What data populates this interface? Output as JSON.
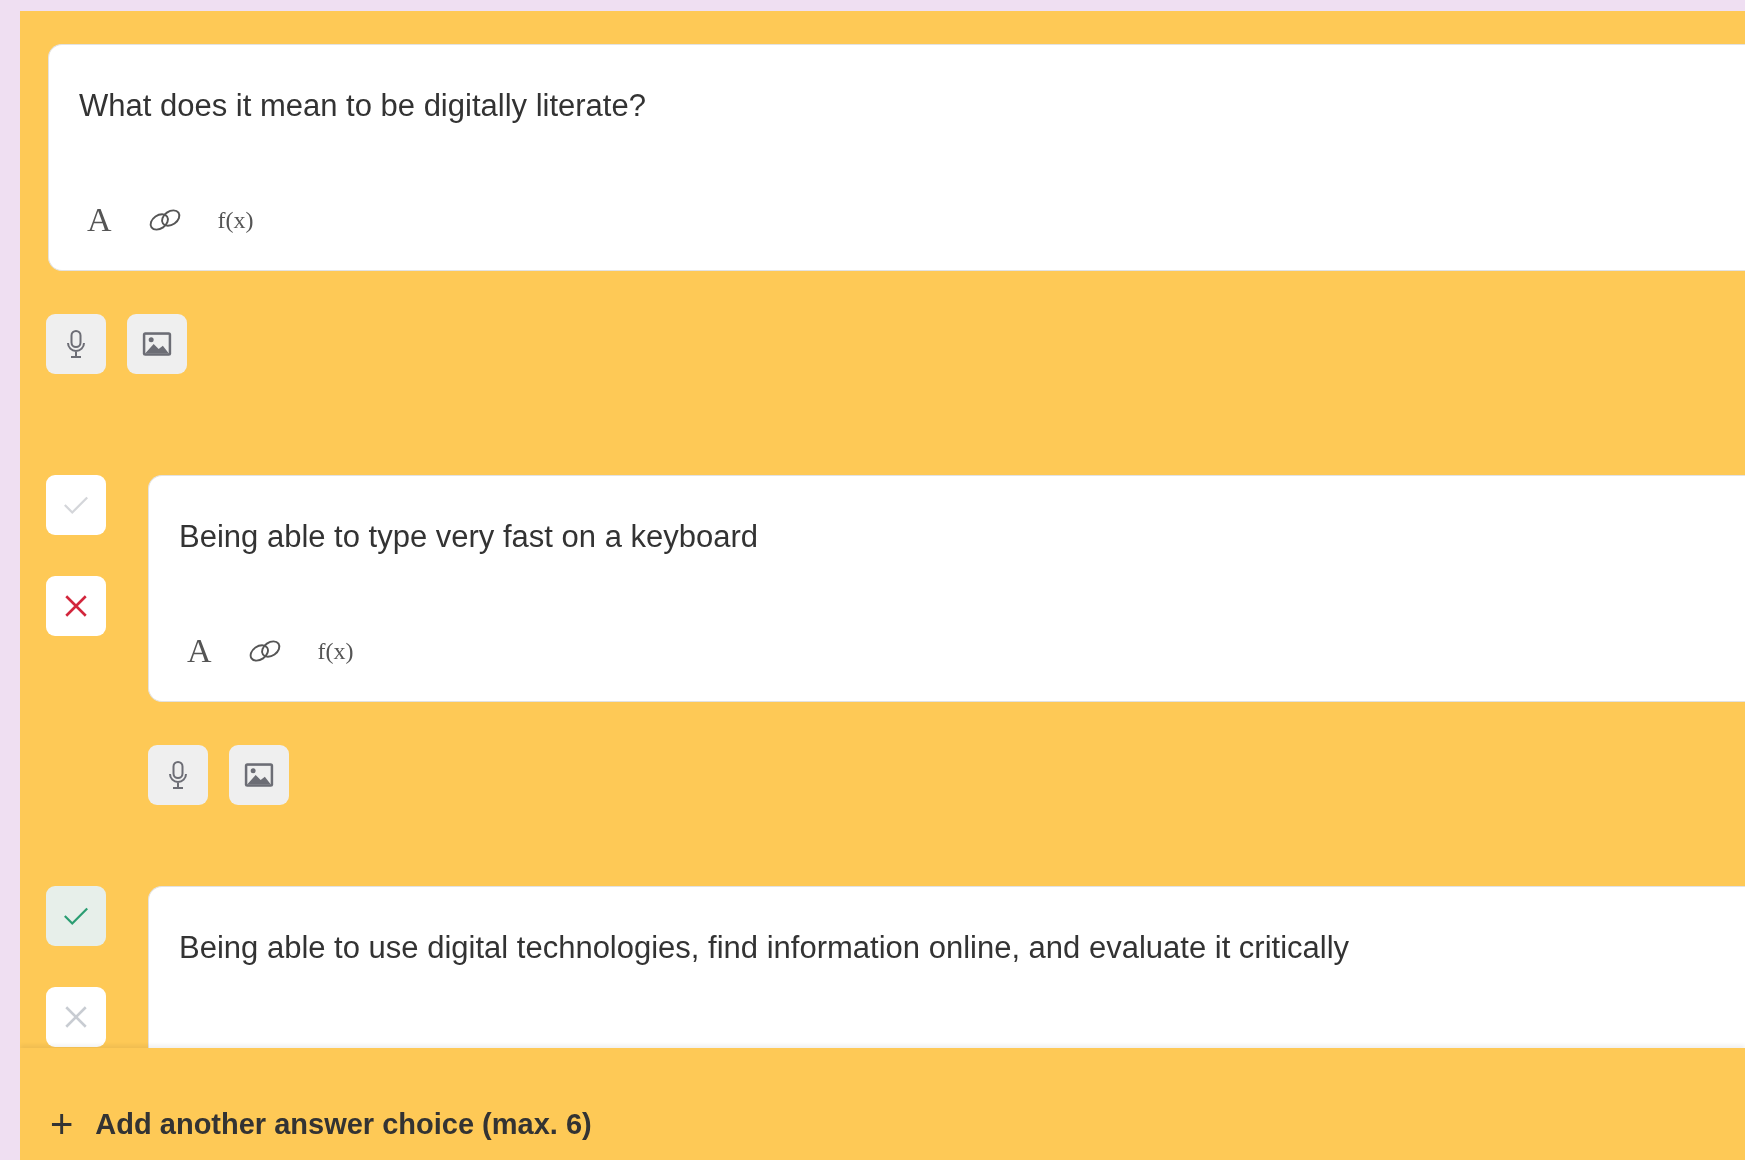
{
  "question": {
    "text": "What does it mean to be digitally literate?",
    "format_tools": [
      {
        "kind": "font",
        "label": "A"
      },
      {
        "kind": "link"
      },
      {
        "kind": "formula",
        "label": "f(x)"
      }
    ]
  },
  "answers": [
    {
      "text": "Being able to type very fast on a keyboard",
      "correct": false,
      "format_tools": [
        {
          "kind": "font",
          "label": "A"
        },
        {
          "kind": "link"
        },
        {
          "kind": "formula",
          "label": "f(x)"
        }
      ]
    },
    {
      "text": "Being able to use digital technologies, find information online, and evaluate it critically",
      "correct": true
    }
  ],
  "add_choice": {
    "icon": "+",
    "label": "Add another answer choice (max. 6)"
  }
}
